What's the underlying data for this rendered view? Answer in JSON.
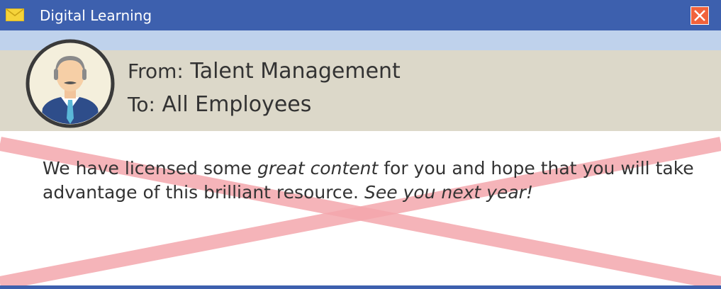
{
  "window": {
    "title": "Digital Learning",
    "icons": {
      "mail": "envelope-icon",
      "close": "close-icon"
    },
    "colors": {
      "titlebar": "#3d60ae",
      "close": "#f1623b",
      "header": "#dcd8c9",
      "band": "#bfd2ec",
      "cross": "#f4a7ad"
    }
  },
  "header": {
    "from_label": "From:",
    "from_value": " Talent Management",
    "to_label": "To:",
    "to_value": " All Employees",
    "avatar": "businessman-avatar"
  },
  "message": {
    "part1": "We have licensed some ",
    "emphasis1": "great content",
    "part2": " for you and hope that you will take advantage of this brilliant resource. ",
    "emphasis2": "See you next year!"
  }
}
